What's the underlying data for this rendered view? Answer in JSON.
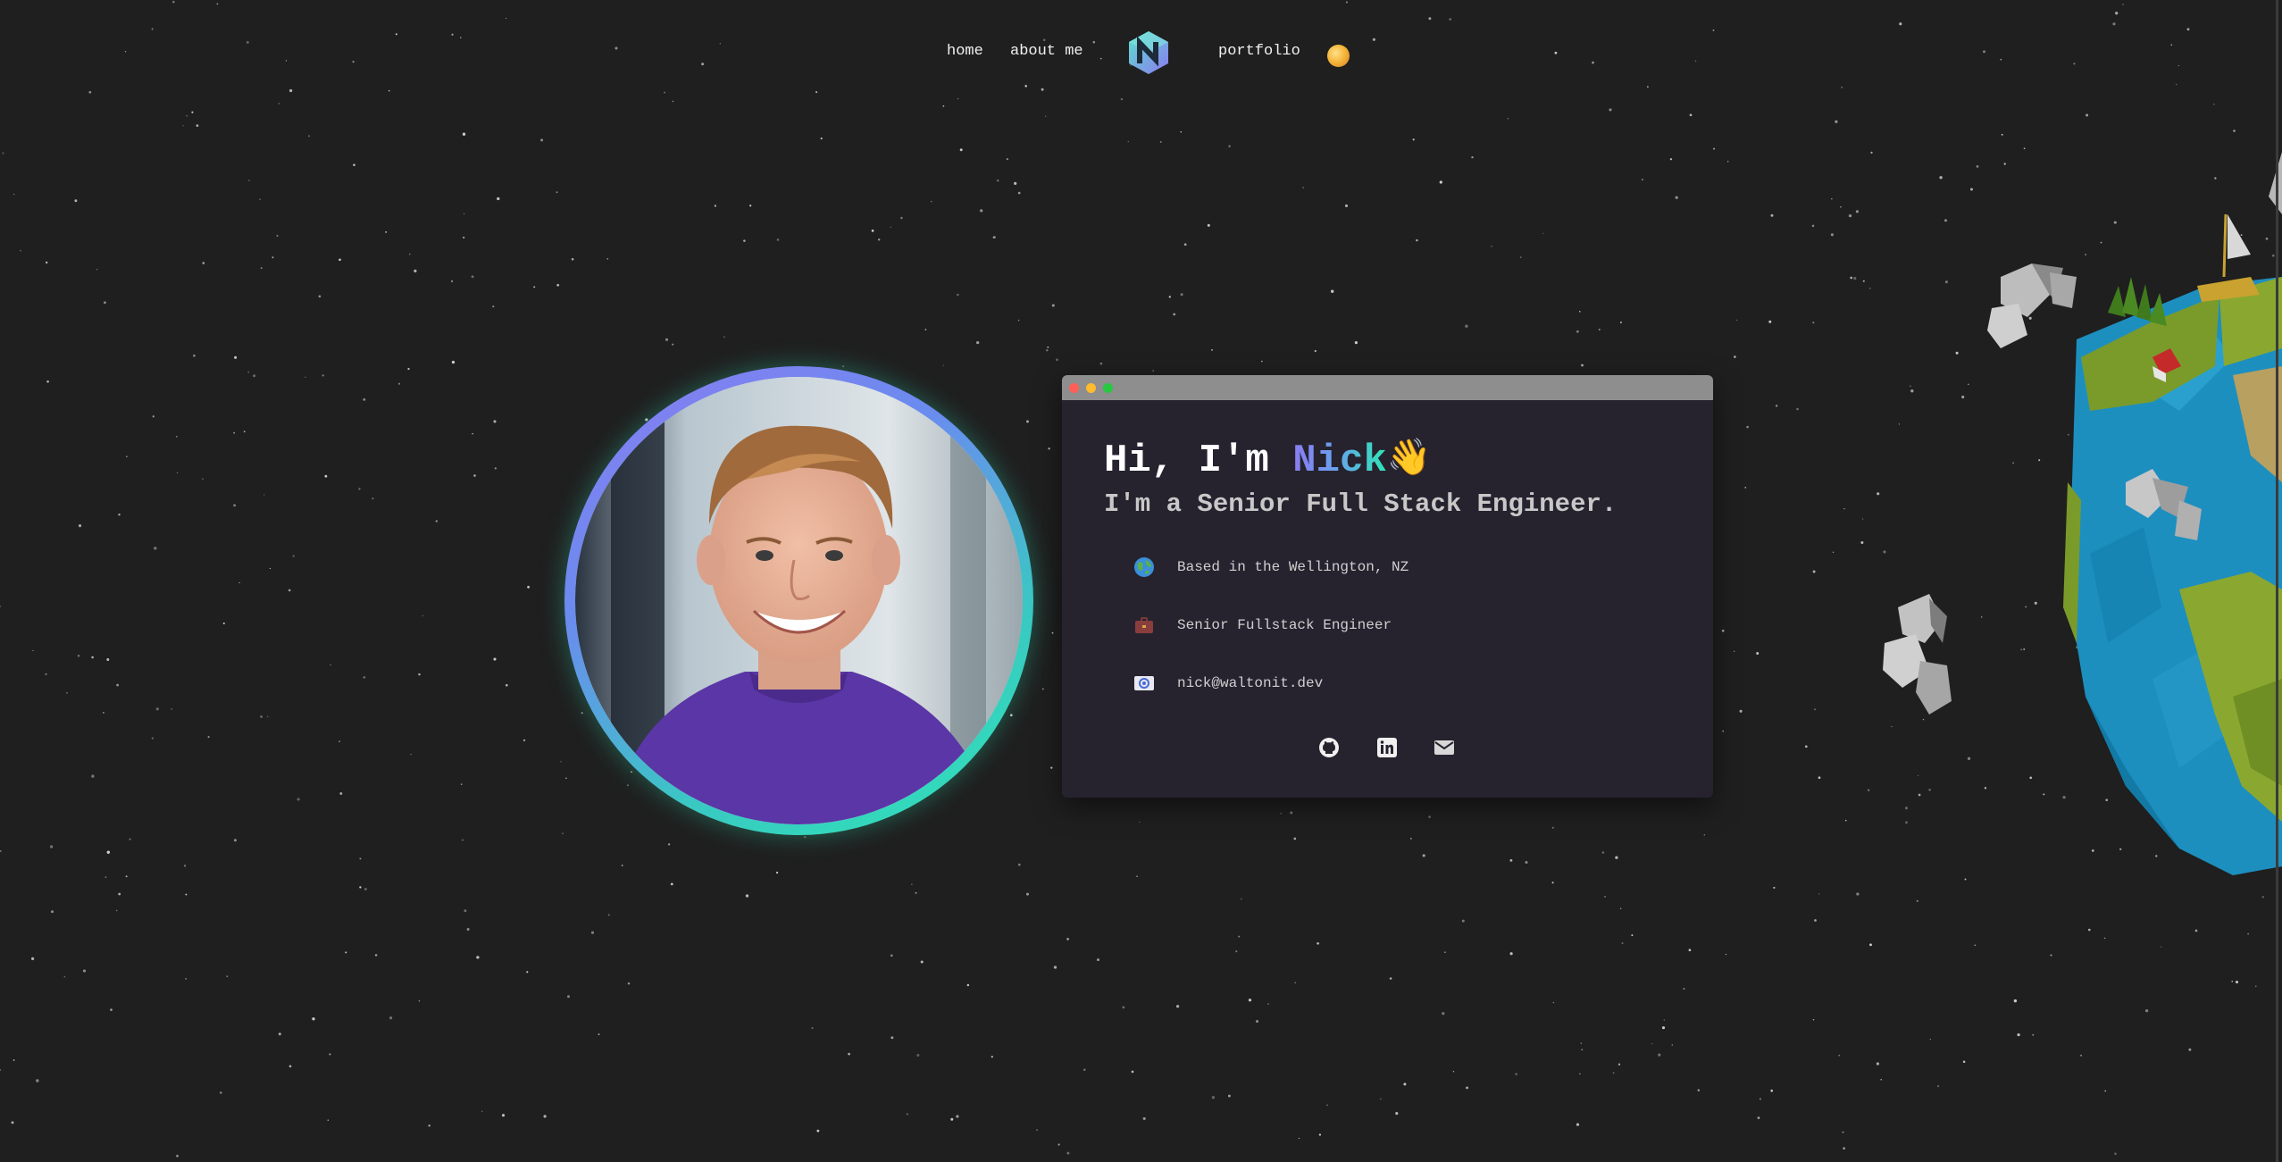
{
  "nav": {
    "home": "home",
    "about": "about me",
    "portfolio": "portfolio",
    "logo_letter": "N"
  },
  "hero": {
    "greeting_prefix": "Hi, I'm ",
    "name": "Nick",
    "wave": "👋",
    "subtitle": "I'm a Senior Full Stack Engineer."
  },
  "info": [
    {
      "icon": "globe-icon",
      "text": "Based in the Wellington, NZ"
    },
    {
      "icon": "briefcase-icon",
      "text": "Senior Fullstack Engineer"
    },
    {
      "icon": "email-icon",
      "text": "nick@waltonit.dev"
    }
  ],
  "socials": [
    "github-icon",
    "linkedin-icon",
    "mail-icon"
  ],
  "colors": {
    "background": "#1f1f1f",
    "card": "#26232f",
    "card_bar": "#8e8e8e",
    "gradient_start": "#8a7bf0",
    "gradient_end": "#2ee6b6"
  }
}
